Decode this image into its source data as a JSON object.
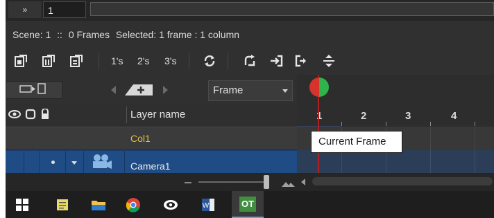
{
  "top": {
    "chevron": "»",
    "frame_value": "1"
  },
  "scene_info": {
    "scene": "Scene: 1",
    "separator": "::",
    "frames": "0 Frames",
    "selected": "Selected: 1 frame : 1 column"
  },
  "toolbar": {
    "step_labels": [
      "1's",
      "2's",
      "3's"
    ],
    "icons": [
      "new-level-icon",
      "new-raster-level-icon",
      "new-vector-level-icon",
      "rotate-icon",
      "redo-icon",
      "import-icon",
      "export-icon",
      "swap-icon"
    ]
  },
  "controls": {
    "frame_select": "Frame"
  },
  "layer_header": {
    "label": "Layer name"
  },
  "layers": [
    {
      "name": "Col1",
      "color": "#d9c24a"
    },
    {
      "name": "Camera1",
      "color": "#1f4c84"
    }
  ],
  "timeline": {
    "frame_numbers": [
      "1",
      "2",
      "3",
      "4"
    ],
    "current_frame": 1
  },
  "tooltip": {
    "text": "Current Frame"
  },
  "taskbar": {
    "apps": [
      "windows-start",
      "notes",
      "file-explorer",
      "chrome",
      "eye-app",
      "word",
      "opentoonz"
    ],
    "active_app": "OT"
  },
  "colors": {
    "accent": "#1f4c84",
    "playhead": "#b02020",
    "current_column": "#3a4a72",
    "col1_text": "#d9c24a"
  }
}
